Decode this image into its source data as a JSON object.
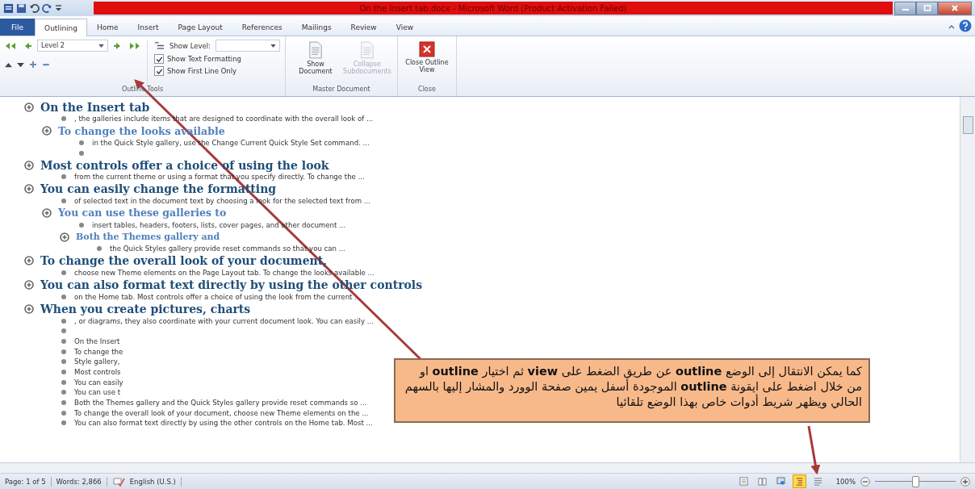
{
  "window": {
    "title": "On the Insert tab.docx - Microsoft Word (Product Activation Failed)"
  },
  "tabs": [
    {
      "label": "File",
      "kind": "file",
      "selected": false
    },
    {
      "label": "Outlining",
      "kind": "tab",
      "selected": true
    },
    {
      "label": "Home",
      "kind": "tab",
      "selected": false
    },
    {
      "label": "Insert",
      "kind": "tab",
      "selected": false
    },
    {
      "label": "Page Layout",
      "kind": "tab",
      "selected": false
    },
    {
      "label": "References",
      "kind": "tab",
      "selected": false
    },
    {
      "label": "Mailings",
      "kind": "tab",
      "selected": false
    },
    {
      "label": "Review",
      "kind": "tab",
      "selected": false
    },
    {
      "label": "View",
      "kind": "tab",
      "selected": false
    }
  ],
  "ribbon": {
    "outline_tools": {
      "label": "Outline Tools",
      "level_value": "Level 2",
      "show_level_label": "Show Level:",
      "checkboxes": [
        {
          "label": "Show Text Formatting",
          "checked": true
        },
        {
          "label": "Show First Line Only",
          "checked": true
        }
      ]
    },
    "master_document": {
      "label": "Master Document",
      "buttons": [
        {
          "label": "Show Document",
          "disabled": false
        },
        {
          "label": "Collapse Subdocuments",
          "disabled": true
        }
      ]
    },
    "close": {
      "label": "Close",
      "button": "Close Outline View"
    }
  },
  "outline": [
    {
      "kind": "heading",
      "text": "On the Insert tab",
      "children": [
        {
          "kind": "body",
          "text": ", the galleries include items that are designed to coordinate with the overall look of ..."
        },
        {
          "kind": "heading",
          "text": "To change the looks available",
          "children": [
            {
              "kind": "body",
              "text": "in the Quick Style gallery, use the Change Current Quick Style Set command. ..."
            },
            {
              "kind": "empty"
            }
          ]
        }
      ]
    },
    {
      "kind": "heading",
      "text": "Most controls offer a choice of using the look",
      "children": [
        {
          "kind": "body",
          "text": "from the current theme or using a format that you specify directly. To change the ..."
        }
      ]
    },
    {
      "kind": "heading",
      "text": "You can easily change the formatting",
      "children": [
        {
          "kind": "body",
          "text": "of selected text in the document text by choosing a look for the selected text from ..."
        },
        {
          "kind": "heading",
          "text": "You can use these galleries to",
          "children": [
            {
              "kind": "body",
              "text": "insert tables, headers, footers, lists, cover pages, and other document ..."
            },
            {
              "kind": "heading",
              "text": "Both the Themes gallery and",
              "children": [
                {
                  "kind": "body",
                  "text": "the Quick Styles gallery provide reset commands so that you can ..."
                }
              ]
            }
          ]
        }
      ]
    },
    {
      "kind": "heading",
      "text": "To change the overall look of your document,",
      "children": [
        {
          "kind": "body",
          "text": "choose new Theme elements on the Page Layout tab. To change the looks available ..."
        }
      ]
    },
    {
      "kind": "heading",
      "text": "You can also format text directly by using the other controls",
      "children": [
        {
          "kind": "body",
          "text": "on the Home tab. Most controls offer a choice of using the look from the current ..."
        }
      ]
    },
    {
      "kind": "heading",
      "text": "When you create pictures, charts",
      "children": [
        {
          "kind": "body",
          "text": ", or diagrams, they also coordinate with your current document look. You can easily ..."
        },
        {
          "kind": "empty"
        },
        {
          "kind": "body",
          "text": "On the Insert"
        },
        {
          "kind": "body",
          "text": "To change the"
        },
        {
          "kind": "body",
          "text": "Style gallery,"
        },
        {
          "kind": "body",
          "text": "Most controls"
        },
        {
          "kind": "body",
          "text": "You can easily"
        },
        {
          "kind": "body",
          "text": "You can use t"
        },
        {
          "kind": "body",
          "text": "Both the Themes gallery and the Quick Styles gallery provide reset commands so ..."
        },
        {
          "kind": "body",
          "text": "To change the overall look of your document, choose new Theme elements on the ..."
        },
        {
          "kind": "body",
          "text": "You can also format text directly by using the other controls on the Home tab. Most ..."
        }
      ]
    }
  ],
  "callout": {
    "text": "كما يمكن الانتقال إلى الوضع **outline** عن طريق الضغط على **view** ثم اختيار **outline** او من خلال اضغط على ايقونة **outline** الموجودة  أسفل يمين صفحة الوورد والمشار إليها بالسهم الحالي ويظهر شريط أدوات خاص بهذا الوضع  تلقائيا"
  },
  "status_bar": {
    "page": "Page: 1 of 5",
    "words": "Words: 2,866",
    "language": "English (U.S.)",
    "views": [
      {
        "kind": "print",
        "selected": false
      },
      {
        "kind": "reading",
        "selected": false
      },
      {
        "kind": "web",
        "selected": false
      },
      {
        "kind": "outline",
        "selected": true
      },
      {
        "kind": "draft",
        "selected": false
      }
    ],
    "zoom": "100%",
    "zoom_level": {
      "level": 0.5
    }
  }
}
